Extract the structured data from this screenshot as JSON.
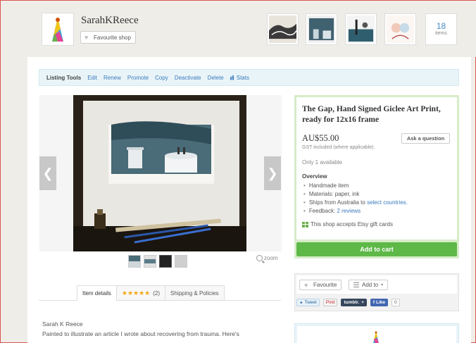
{
  "shop": {
    "name": "SarahKReece",
    "favourite_label": "Favourite shop",
    "items_count": "18",
    "items_label": "items"
  },
  "listing_tools": {
    "title": "Listing Tools",
    "links": [
      "Edit",
      "Renew",
      "Promote",
      "Copy",
      "Deactivate",
      "Delete"
    ],
    "stats_label": "Stats"
  },
  "gallery": {
    "zoom_label": "zoom",
    "prev_icon": "chevron-left-icon",
    "next_icon": "chevron-right-icon"
  },
  "tabs": {
    "item_details": "Item details",
    "reviews_count": "(2)",
    "reviews_stars": "★★★★★",
    "shipping": "Shipping & Policies"
  },
  "description": {
    "line1": "Sarah K Reece",
    "line2": "Painted to illustrate an article I wrote about recovering from trauma. Here's"
  },
  "item": {
    "title": "The Gap, Hand Signed Giclee Art Print, ready for 12x16 frame",
    "price": "AU$55.00",
    "gst": "GST included (where applicable).",
    "ask_label": "Ask a question",
    "availability": "Only 1 available",
    "overview_title": "Overview",
    "overview": {
      "handmade": "Handmade item",
      "materials": "Materials: paper, ink",
      "ships_prefix": "Ships from Australia to ",
      "ships_link": "select countries.",
      "feedback_prefix": "Feedback: ",
      "feedback_link": "2 reviews"
    },
    "gift_cards": "This shop accepts Etsy gift cards",
    "cart_label": "Add to cart"
  },
  "social": {
    "favourite_label": "Favourite",
    "add_to_label": "Add to",
    "tweet": "Tweet",
    "pinit": "Pinit",
    "tumblr": "tumblr.",
    "tumblr_plus": "+",
    "like": "Like",
    "like_count": "0"
  },
  "colors": {
    "accent_green": "#5db847",
    "link_blue": "#3b7bbf",
    "star_orange": "#f3a712"
  }
}
